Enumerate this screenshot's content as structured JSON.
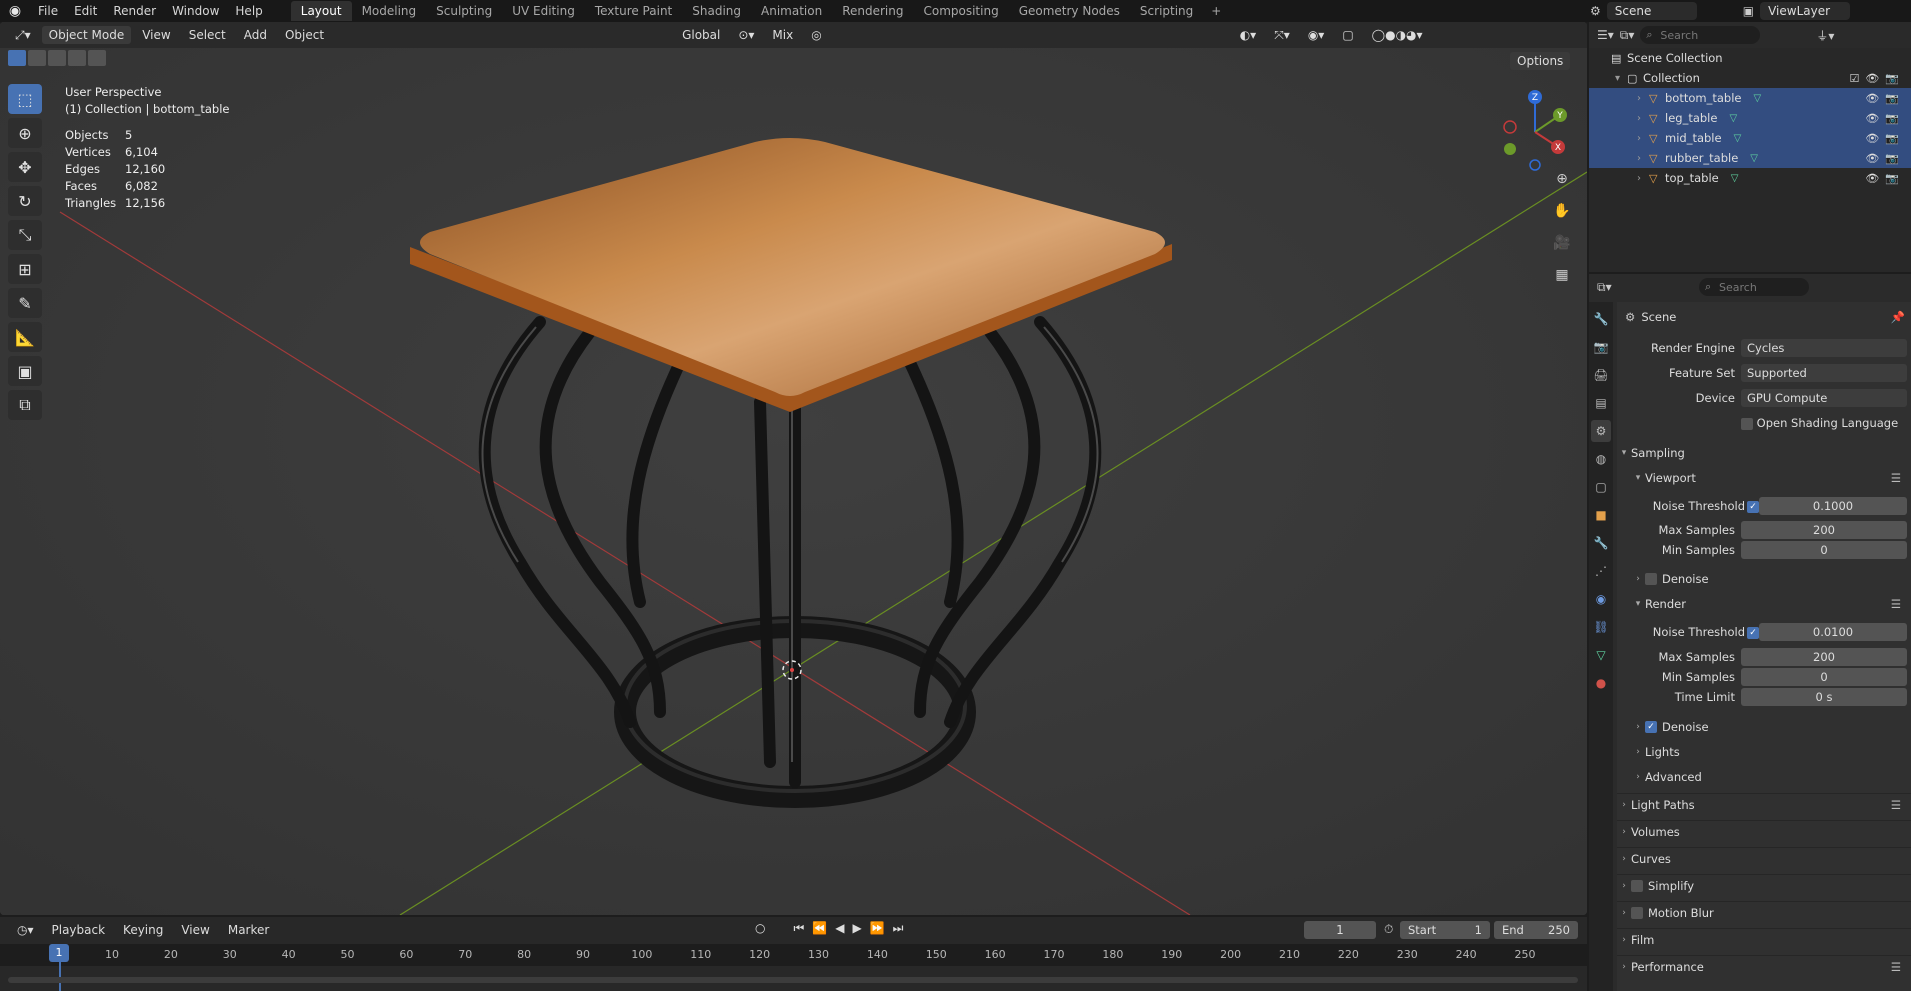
{
  "menu": {
    "items": [
      "File",
      "Edit",
      "Render",
      "Window",
      "Help"
    ]
  },
  "workspaces": [
    "Layout",
    "Modeling",
    "Sculpting",
    "UV Editing",
    "Texture Paint",
    "Shading",
    "Animation",
    "Rendering",
    "Compositing",
    "Geometry Nodes",
    "Scripting"
  ],
  "active_workspace": "Layout",
  "scene_name": "Scene",
  "view_layer": "ViewLayer",
  "viewport": {
    "mode": "Object Mode",
    "menus": [
      "View",
      "Select",
      "Add",
      "Object"
    ],
    "transform_orientation": "Global",
    "snap_mode": "Mix",
    "options_label": "Options",
    "view_name": "User Perspective",
    "collection_info": "(1) Collection | bottom_table",
    "stats": [
      {
        "label": "Objects",
        "value": "5"
      },
      {
        "label": "Vertices",
        "value": "6,104"
      },
      {
        "label": "Edges",
        "value": "12,160"
      },
      {
        "label": "Faces",
        "value": "6,082"
      },
      {
        "label": "Triangles",
        "value": "12,156"
      }
    ],
    "gizmo_axes": [
      "Z",
      "Y",
      "X"
    ]
  },
  "outliner": {
    "search_placeholder": "Search",
    "root": "Scene Collection",
    "collection": "Collection",
    "objects": [
      "bottom_table",
      "leg_table",
      "mid_table",
      "rubber_table",
      "top_table"
    ]
  },
  "properties": {
    "search_placeholder": "Search",
    "context": "Scene",
    "render_engine_label": "Render Engine",
    "render_engine": "Cycles",
    "feature_set_label": "Feature Set",
    "feature_set": "Supported",
    "device_label": "Device",
    "device": "GPU Compute",
    "osl_label": "Open Shading Language",
    "sampling": "Sampling",
    "viewport_sec": "Viewport",
    "noise_threshold_label": "Noise Threshold",
    "vp_noise": "0.1000",
    "max_samples_label": "Max Samples",
    "vp_max": "200",
    "min_samples_label": "Min Samples",
    "vp_min": "0",
    "denoise_label": "Denoise",
    "render_sec": "Render",
    "r_noise": "0.0100",
    "r_max": "200",
    "r_min": "0",
    "time_limit_label": "Time Limit",
    "r_time": "0 s",
    "lights": "Lights",
    "advanced": "Advanced",
    "light_paths": "Light Paths",
    "volumes": "Volumes",
    "curves": "Curves",
    "simplify": "Simplify",
    "motion_blur": "Motion Blur",
    "film": "Film",
    "performance": "Performance"
  },
  "timeline": {
    "menus": [
      "Playback",
      "Keying",
      "View",
      "Marker"
    ],
    "current_frame": "1",
    "start_label": "Start",
    "start": "1",
    "end_label": "End",
    "end": "250",
    "ticks": [
      "1",
      "10",
      "20",
      "30",
      "40",
      "50",
      "60",
      "70",
      "80",
      "90",
      "100",
      "110",
      "120",
      "130",
      "140",
      "150",
      "160",
      "170",
      "180",
      "190",
      "200",
      "210",
      "220",
      "230",
      "240",
      "250"
    ]
  },
  "colors": {
    "accent": "#4772b3",
    "selected_row": "#334d80",
    "wood": "#b86a2c",
    "metal": "#1b1b1b"
  }
}
